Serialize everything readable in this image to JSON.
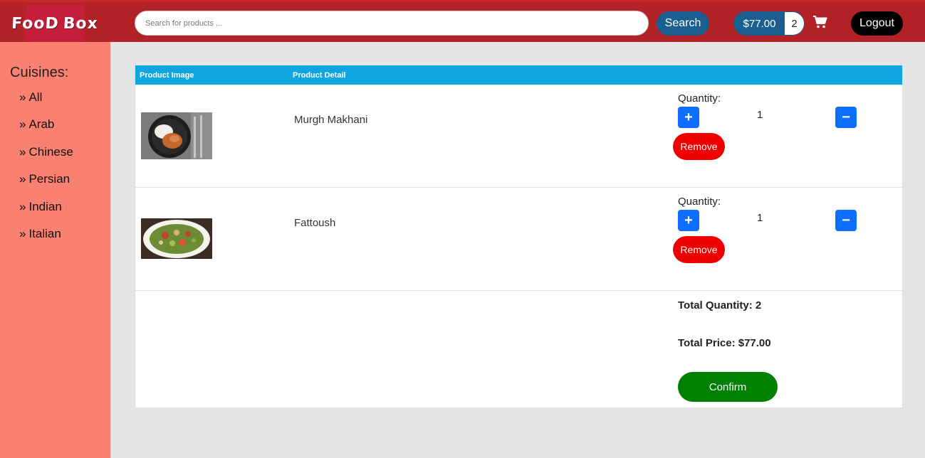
{
  "header": {
    "logo_text_1": "FooD",
    "logo_text_2": "Box",
    "search_placeholder": "Search for products ...",
    "search_label": "Search",
    "cart_total": "$77.00",
    "cart_count": "2",
    "logout_label": "Logout"
  },
  "sidebar": {
    "title": "Cuisines:",
    "items": [
      {
        "label": "All"
      },
      {
        "label": "Arab"
      },
      {
        "label": "Chinese"
      },
      {
        "label": "Persian"
      },
      {
        "label": "Indian"
      },
      {
        "label": "Italian"
      }
    ]
  },
  "table": {
    "col_image": "Product Image",
    "col_detail": "Product Detail",
    "rows": [
      {
        "name": "Murgh Makhani",
        "quantity_label": "Quantity:",
        "quantity": "1",
        "plus": "+",
        "minus": "−",
        "remove_label": "Remove"
      },
      {
        "name": "Fattoush",
        "quantity_label": "Quantity:",
        "quantity": "1",
        "plus": "+",
        "minus": "−",
        "remove_label": "Remove"
      }
    ]
  },
  "summary": {
    "total_quantity": "Total Quantity: 2",
    "total_price": "Total Price: $77.00",
    "confirm_label": "Confirm"
  },
  "colors": {
    "header": "#b22226",
    "sidebar": "#fa8072",
    "table_head": "#0ea5e0",
    "primary": "#0d6efd",
    "remove": "#ee0000",
    "confirm": "#008000"
  }
}
